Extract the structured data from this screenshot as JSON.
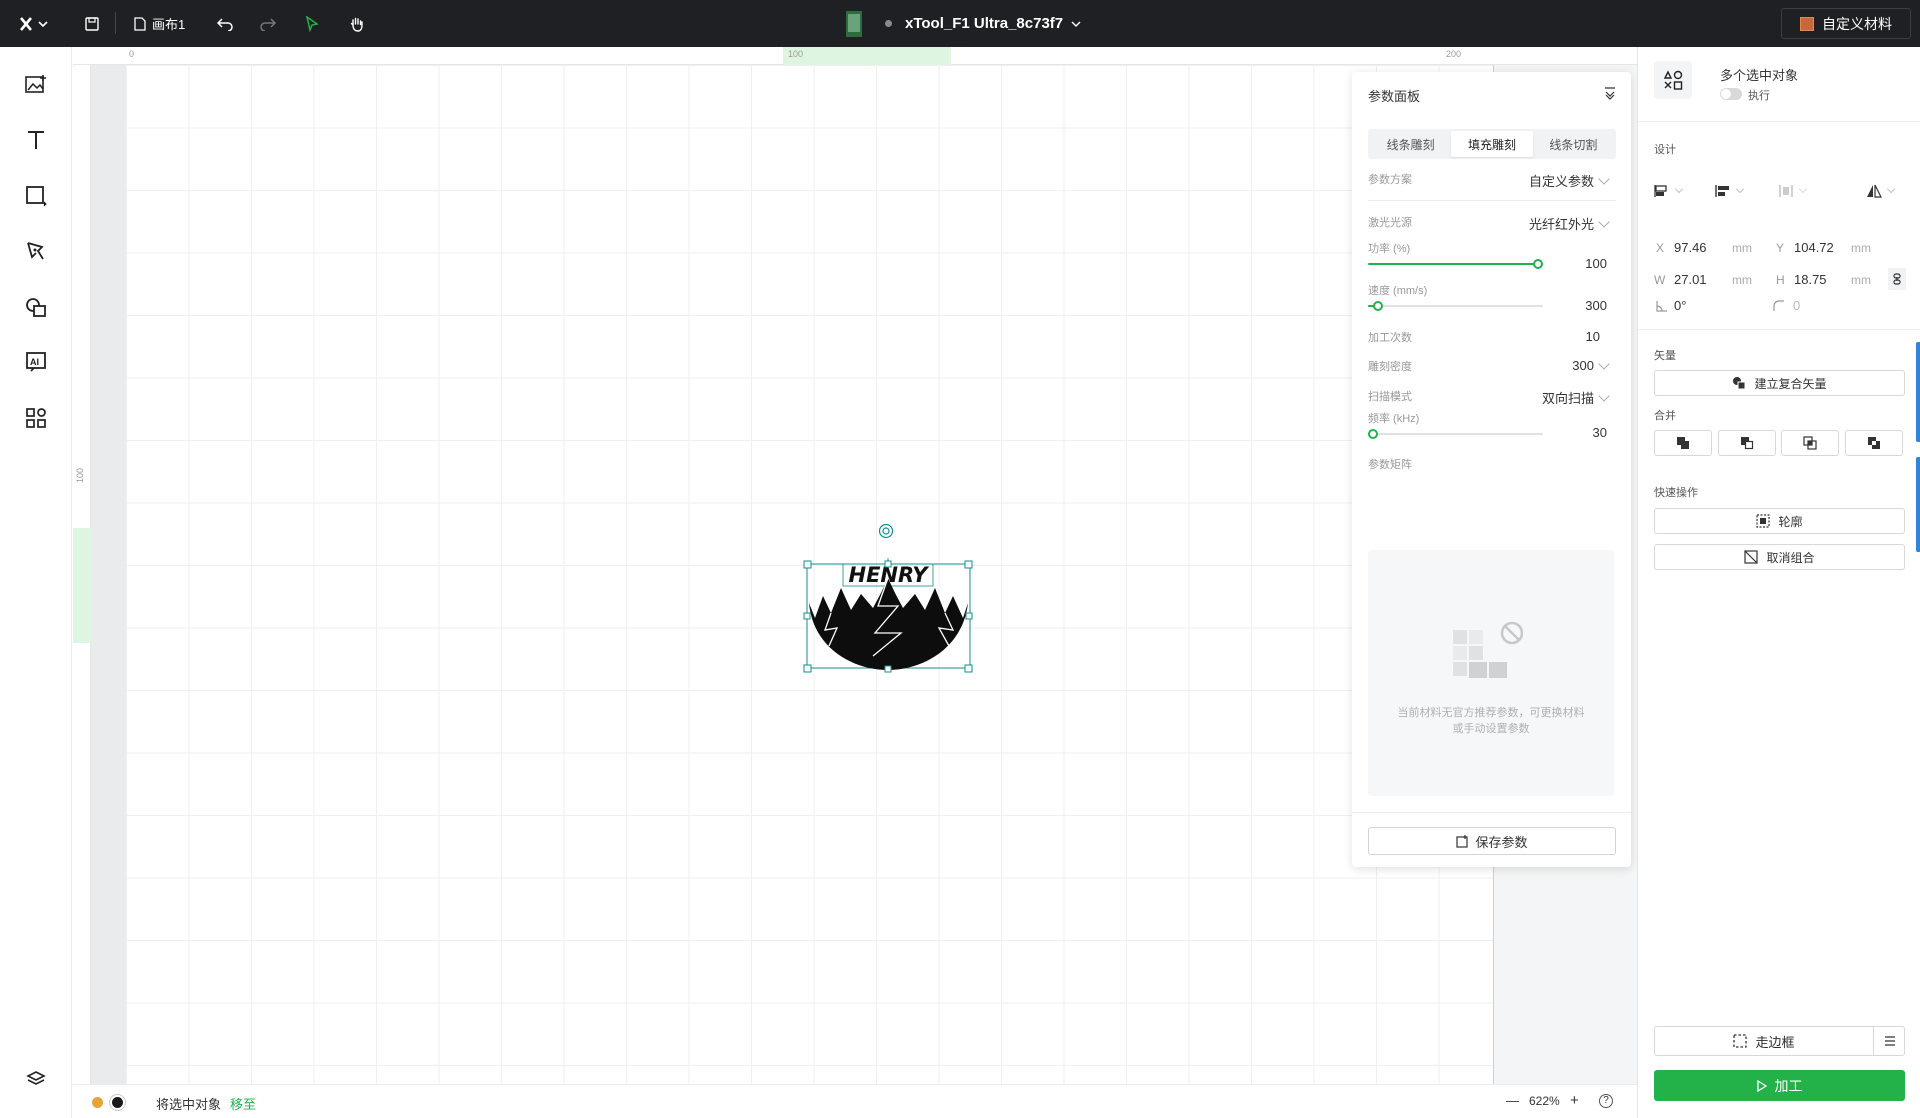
{
  "topbar": {
    "canvas_name": "画布1",
    "device_name": "xTool_F1 Ultra_8c73f7",
    "custom_material_label": "自定义材料"
  },
  "rulers": {
    "top_ticks": [
      "0",
      "100",
      "200"
    ],
    "left_ticks": [
      "100"
    ]
  },
  "status_bar": {
    "move_prefix": "将选中对象",
    "move_link": "移至",
    "zoom_level": "622%",
    "zoom_out_symbol": "—",
    "zoom_in_symbol": "+",
    "help_symbol": "?"
  },
  "param_panel": {
    "title": "参数面板",
    "tabs": [
      "线条雕刻",
      "填充雕刻",
      "线条切割"
    ],
    "active_tab": "填充雕刻",
    "scheme_label": "参数方案",
    "scheme_value": "自定义参数",
    "laser_source_label": "激光光源",
    "laser_source_value": "光纤红外光",
    "power_label": "功率 (%)",
    "power_value": "100",
    "speed_label": "速度 (mm/s)",
    "speed_value": "300",
    "passes_label": "加工次数",
    "passes_value": "10",
    "density_label": "雕刻密度",
    "density_value": "300",
    "scan_mode_label": "扫描模式",
    "scan_mode_value": "双向扫描",
    "frequency_label": "频率 (kHz)",
    "frequency_value": "30",
    "matrix_label": "参数矩阵",
    "matrix_empty_line1": "当前材料无官方推荐参数，可更换材料",
    "matrix_empty_line2": "或手动设置参数",
    "save_label": "保存参数",
    "slider_levels": {
      "power": 1.0,
      "speed": 0.03,
      "frequency": 0.0
    }
  },
  "right_panel": {
    "selection_title": "多个选中对象",
    "execute_label": "执行",
    "design_label": "设计",
    "x_label": "X",
    "x_value": "97.46",
    "x_unit": "mm",
    "y_label": "Y",
    "y_value": "104.72",
    "y_unit": "mm",
    "w_label": "W",
    "w_value": "27.01",
    "w_unit": "mm",
    "h_label": "H",
    "h_value": "18.75",
    "h_unit": "mm",
    "rotation_value": "0°",
    "corner_value": "0",
    "vector_label": "矢量",
    "compound_vector_label": "建立复合矢量",
    "merge_label": "合并",
    "quick_ops_label": "快速操作",
    "outline_label": "轮廓",
    "ungroup_label": "取消组合",
    "frame_label": "走边框",
    "process_label": "加工"
  },
  "artwork": {
    "text": "HENRY"
  },
  "colors": {
    "accent_green": "#23b14a",
    "topbar_bg": "#1f2023",
    "layer_orange": "#e8a33a",
    "layer_black": "#1a1a1a"
  }
}
